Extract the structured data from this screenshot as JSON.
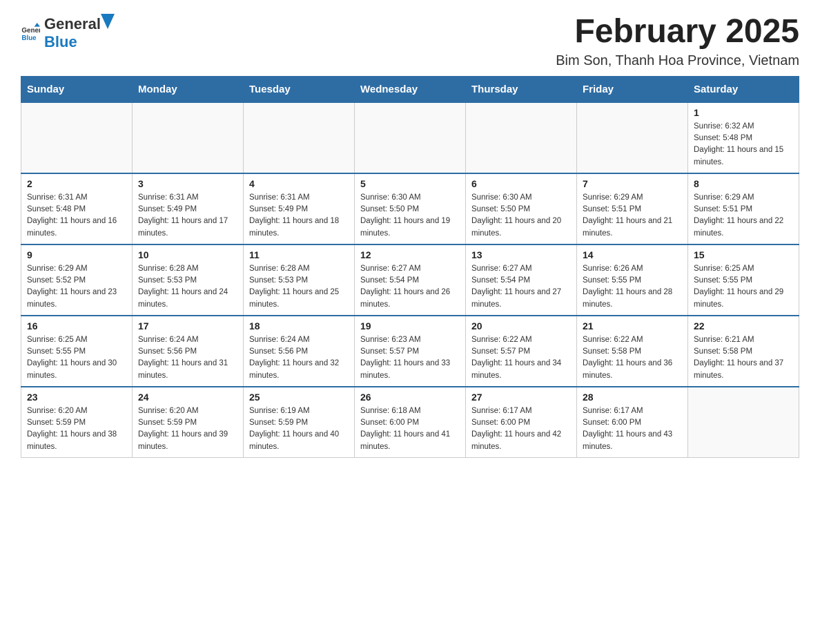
{
  "header": {
    "logo_general": "General",
    "logo_blue": "Blue",
    "title": "February 2025",
    "subtitle": "Bim Son, Thanh Hoa Province, Vietnam"
  },
  "weekdays": [
    "Sunday",
    "Monday",
    "Tuesday",
    "Wednesday",
    "Thursday",
    "Friday",
    "Saturday"
  ],
  "weeks": [
    [
      {
        "day": "",
        "info": ""
      },
      {
        "day": "",
        "info": ""
      },
      {
        "day": "",
        "info": ""
      },
      {
        "day": "",
        "info": ""
      },
      {
        "day": "",
        "info": ""
      },
      {
        "day": "",
        "info": ""
      },
      {
        "day": "1",
        "info": "Sunrise: 6:32 AM\nSunset: 5:48 PM\nDaylight: 11 hours and 15 minutes."
      }
    ],
    [
      {
        "day": "2",
        "info": "Sunrise: 6:31 AM\nSunset: 5:48 PM\nDaylight: 11 hours and 16 minutes."
      },
      {
        "day": "3",
        "info": "Sunrise: 6:31 AM\nSunset: 5:49 PM\nDaylight: 11 hours and 17 minutes."
      },
      {
        "day": "4",
        "info": "Sunrise: 6:31 AM\nSunset: 5:49 PM\nDaylight: 11 hours and 18 minutes."
      },
      {
        "day": "5",
        "info": "Sunrise: 6:30 AM\nSunset: 5:50 PM\nDaylight: 11 hours and 19 minutes."
      },
      {
        "day": "6",
        "info": "Sunrise: 6:30 AM\nSunset: 5:50 PM\nDaylight: 11 hours and 20 minutes."
      },
      {
        "day": "7",
        "info": "Sunrise: 6:29 AM\nSunset: 5:51 PM\nDaylight: 11 hours and 21 minutes."
      },
      {
        "day": "8",
        "info": "Sunrise: 6:29 AM\nSunset: 5:51 PM\nDaylight: 11 hours and 22 minutes."
      }
    ],
    [
      {
        "day": "9",
        "info": "Sunrise: 6:29 AM\nSunset: 5:52 PM\nDaylight: 11 hours and 23 minutes."
      },
      {
        "day": "10",
        "info": "Sunrise: 6:28 AM\nSunset: 5:53 PM\nDaylight: 11 hours and 24 minutes."
      },
      {
        "day": "11",
        "info": "Sunrise: 6:28 AM\nSunset: 5:53 PM\nDaylight: 11 hours and 25 minutes."
      },
      {
        "day": "12",
        "info": "Sunrise: 6:27 AM\nSunset: 5:54 PM\nDaylight: 11 hours and 26 minutes."
      },
      {
        "day": "13",
        "info": "Sunrise: 6:27 AM\nSunset: 5:54 PM\nDaylight: 11 hours and 27 minutes."
      },
      {
        "day": "14",
        "info": "Sunrise: 6:26 AM\nSunset: 5:55 PM\nDaylight: 11 hours and 28 minutes."
      },
      {
        "day": "15",
        "info": "Sunrise: 6:25 AM\nSunset: 5:55 PM\nDaylight: 11 hours and 29 minutes."
      }
    ],
    [
      {
        "day": "16",
        "info": "Sunrise: 6:25 AM\nSunset: 5:55 PM\nDaylight: 11 hours and 30 minutes."
      },
      {
        "day": "17",
        "info": "Sunrise: 6:24 AM\nSunset: 5:56 PM\nDaylight: 11 hours and 31 minutes."
      },
      {
        "day": "18",
        "info": "Sunrise: 6:24 AM\nSunset: 5:56 PM\nDaylight: 11 hours and 32 minutes."
      },
      {
        "day": "19",
        "info": "Sunrise: 6:23 AM\nSunset: 5:57 PM\nDaylight: 11 hours and 33 minutes."
      },
      {
        "day": "20",
        "info": "Sunrise: 6:22 AM\nSunset: 5:57 PM\nDaylight: 11 hours and 34 minutes."
      },
      {
        "day": "21",
        "info": "Sunrise: 6:22 AM\nSunset: 5:58 PM\nDaylight: 11 hours and 36 minutes."
      },
      {
        "day": "22",
        "info": "Sunrise: 6:21 AM\nSunset: 5:58 PM\nDaylight: 11 hours and 37 minutes."
      }
    ],
    [
      {
        "day": "23",
        "info": "Sunrise: 6:20 AM\nSunset: 5:59 PM\nDaylight: 11 hours and 38 minutes."
      },
      {
        "day": "24",
        "info": "Sunrise: 6:20 AM\nSunset: 5:59 PM\nDaylight: 11 hours and 39 minutes."
      },
      {
        "day": "25",
        "info": "Sunrise: 6:19 AM\nSunset: 5:59 PM\nDaylight: 11 hours and 40 minutes."
      },
      {
        "day": "26",
        "info": "Sunrise: 6:18 AM\nSunset: 6:00 PM\nDaylight: 11 hours and 41 minutes."
      },
      {
        "day": "27",
        "info": "Sunrise: 6:17 AM\nSunset: 6:00 PM\nDaylight: 11 hours and 42 minutes."
      },
      {
        "day": "28",
        "info": "Sunrise: 6:17 AM\nSunset: 6:00 PM\nDaylight: 11 hours and 43 minutes."
      },
      {
        "day": "",
        "info": ""
      }
    ]
  ]
}
